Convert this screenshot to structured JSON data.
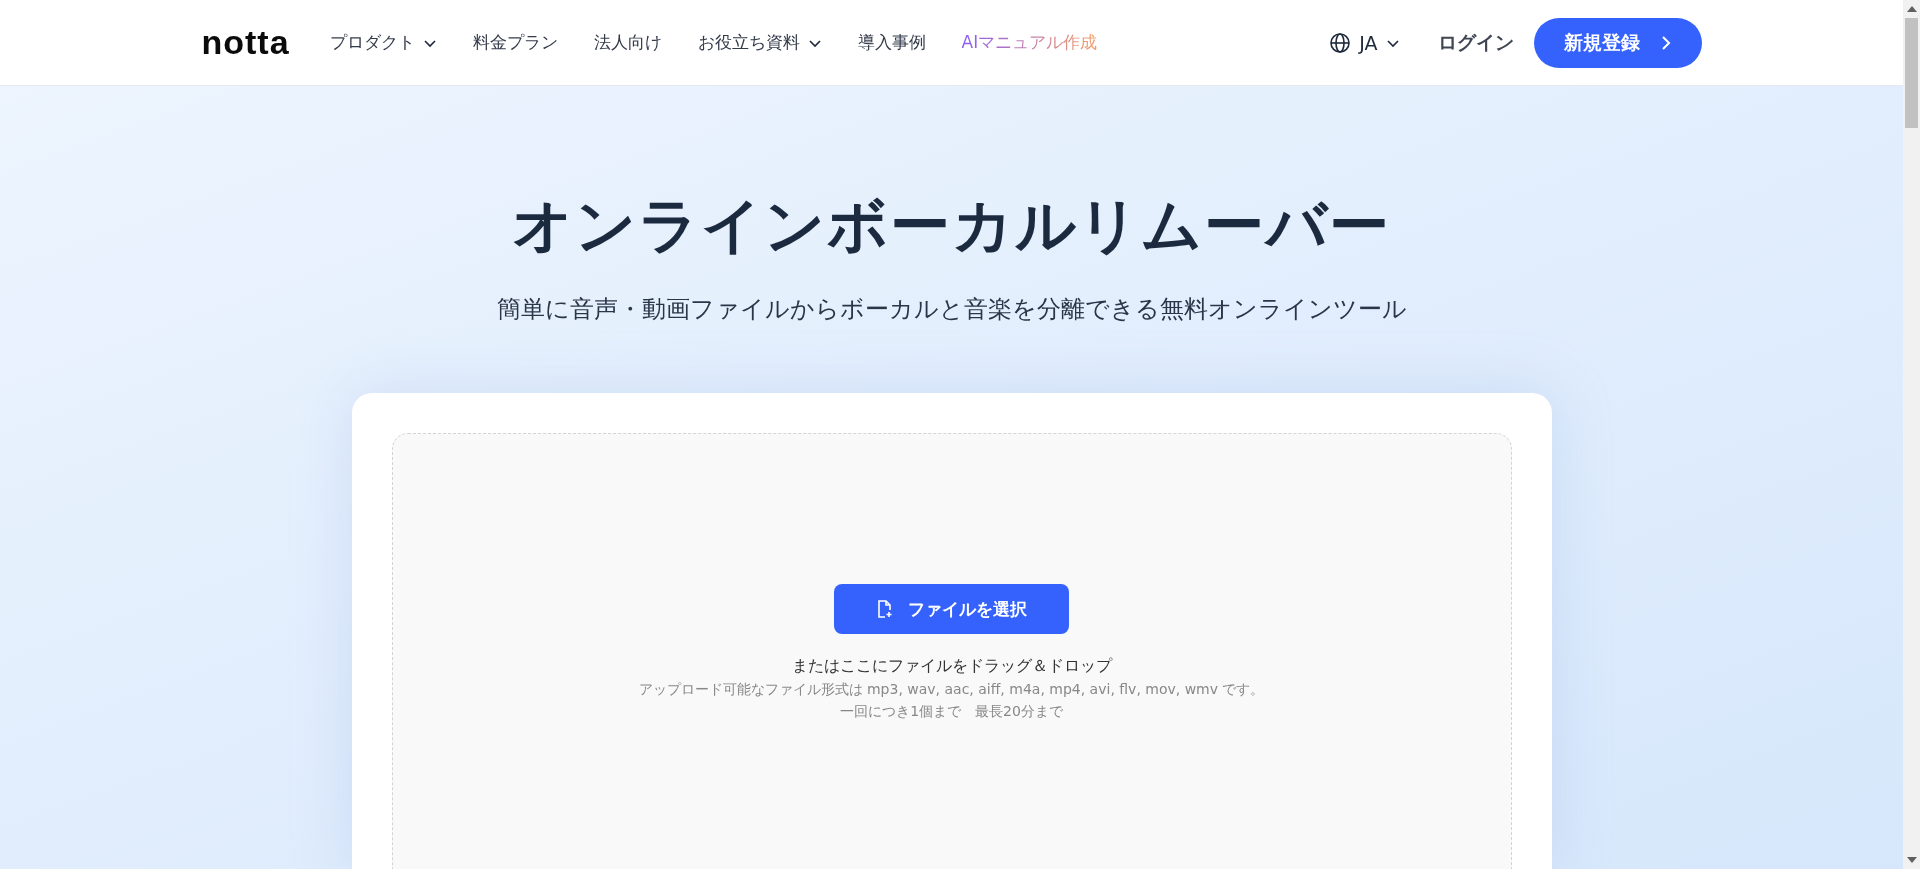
{
  "header": {
    "logo": "notta",
    "nav": [
      {
        "label": "プロダクト",
        "has_menu": true,
        "kind": "plain"
      },
      {
        "label": "料金プラン",
        "has_menu": false,
        "kind": "plain"
      },
      {
        "label": "法人向け",
        "has_menu": false,
        "kind": "plain"
      },
      {
        "label": "お役立ち資料",
        "has_menu": true,
        "kind": "plain"
      },
      {
        "label": "導入事例",
        "has_menu": false,
        "kind": "plain"
      },
      {
        "label": "AIマニュアル作成",
        "has_menu": false,
        "kind": "highlight"
      }
    ],
    "language": "JA",
    "login": "ログイン",
    "signup": "新規登録"
  },
  "hero": {
    "title": "オンラインボーカルリムーバー",
    "subtitle": "簡単に音声・動画ファイルからボーカルと音楽を分離できる無料オンラインツール"
  },
  "upload": {
    "button": "ファイルを選択",
    "drop_hint": "またはここにファイルをドラッグ＆ドロップ",
    "formats": "アップロード可能なファイル形式は mp3, wav, aac, aiff, m4a, mp4, avi, flv, mov, wmv です。",
    "limits": "一回につき1個まで　最長20分まで"
  }
}
